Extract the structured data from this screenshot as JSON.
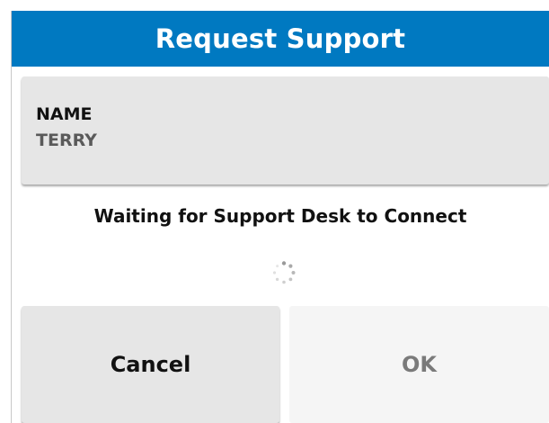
{
  "dialog": {
    "title": "Request Support"
  },
  "name_field": {
    "label": "NAME",
    "value": "TERRY"
  },
  "status": {
    "message": "Waiting for Support Desk to Connect",
    "spinner_icon": "loading-spinner-icon"
  },
  "buttons": {
    "cancel_label": "Cancel",
    "ok_label": "OK"
  },
  "colors": {
    "title_bar": "#0079c1",
    "button_bg": "#e6e6e6",
    "disabled_text": "#7a7a7a"
  }
}
